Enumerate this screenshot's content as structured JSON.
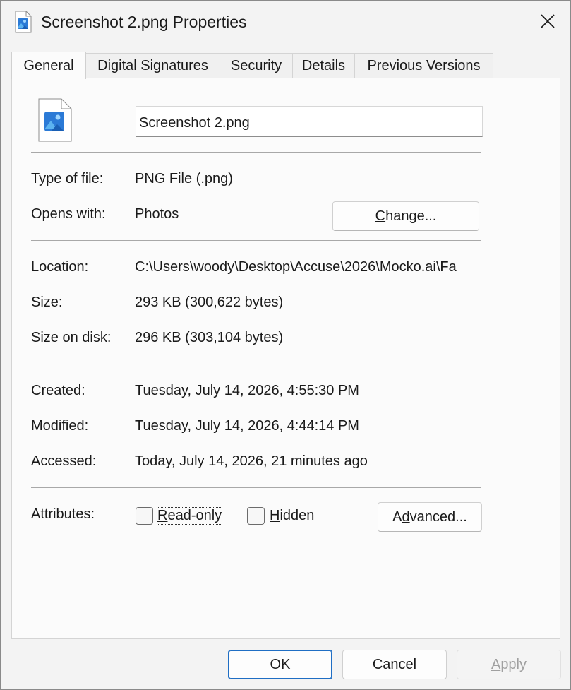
{
  "window": {
    "title": "Screenshot 2.png Properties",
    "title_icon": "image-file-icon",
    "close_icon": "close-icon"
  },
  "tabs": [
    {
      "label": "General",
      "active": true
    },
    {
      "label": "Digital Signatures",
      "active": false
    },
    {
      "label": "Security",
      "active": false
    },
    {
      "label": "Details",
      "active": false
    },
    {
      "label": "Previous Versions",
      "active": false
    }
  ],
  "general": {
    "file_name": "Screenshot 2.png",
    "file_icon": "image-file-icon",
    "type_label": "Type of file:",
    "type_value": "PNG File (.png)",
    "opens_label": "Opens with:",
    "opens_value": "Photos",
    "change_button_pre": "",
    "change_button_mnemonic": "C",
    "change_button_post": "hange...",
    "location_label": "Location:",
    "location_value": "C:\\Users\\woody\\Desktop\\Accuse\\2026\\Mocko.ai\\Fa",
    "size_label": "Size:",
    "size_value": "293 KB (300,622 bytes)",
    "size_on_disk_label": "Size on disk:",
    "size_on_disk_value": "296 KB (303,104 bytes)",
    "created_label": "Created:",
    "created_value": "Tuesday, July 14, 2026, 4:55:30 PM",
    "modified_label": "Modified:",
    "modified_value": "Tuesday, July 14, 2026, 4:44:14 PM",
    "accessed_label": "Accessed:",
    "accessed_value": "Today, July 14, 2026, 21 minutes ago",
    "attributes_label": "Attributes:",
    "readonly_mnemonic": "R",
    "readonly_rest": "ead-only",
    "readonly_checked": false,
    "hidden_mnemonic": "H",
    "hidden_rest": "idden",
    "hidden_checked": false,
    "advanced_pre": "A",
    "advanced_mnemonic": "d",
    "advanced_post": "vanced..."
  },
  "footer": {
    "ok_label": "OK",
    "cancel_label": "Cancel",
    "apply_mnemonic": "A",
    "apply_rest": "pply"
  },
  "colors": {
    "accent": "#1f6ec4",
    "icon_blue": "#2b7ad6",
    "icon_light_blue": "#5cb3f0"
  }
}
